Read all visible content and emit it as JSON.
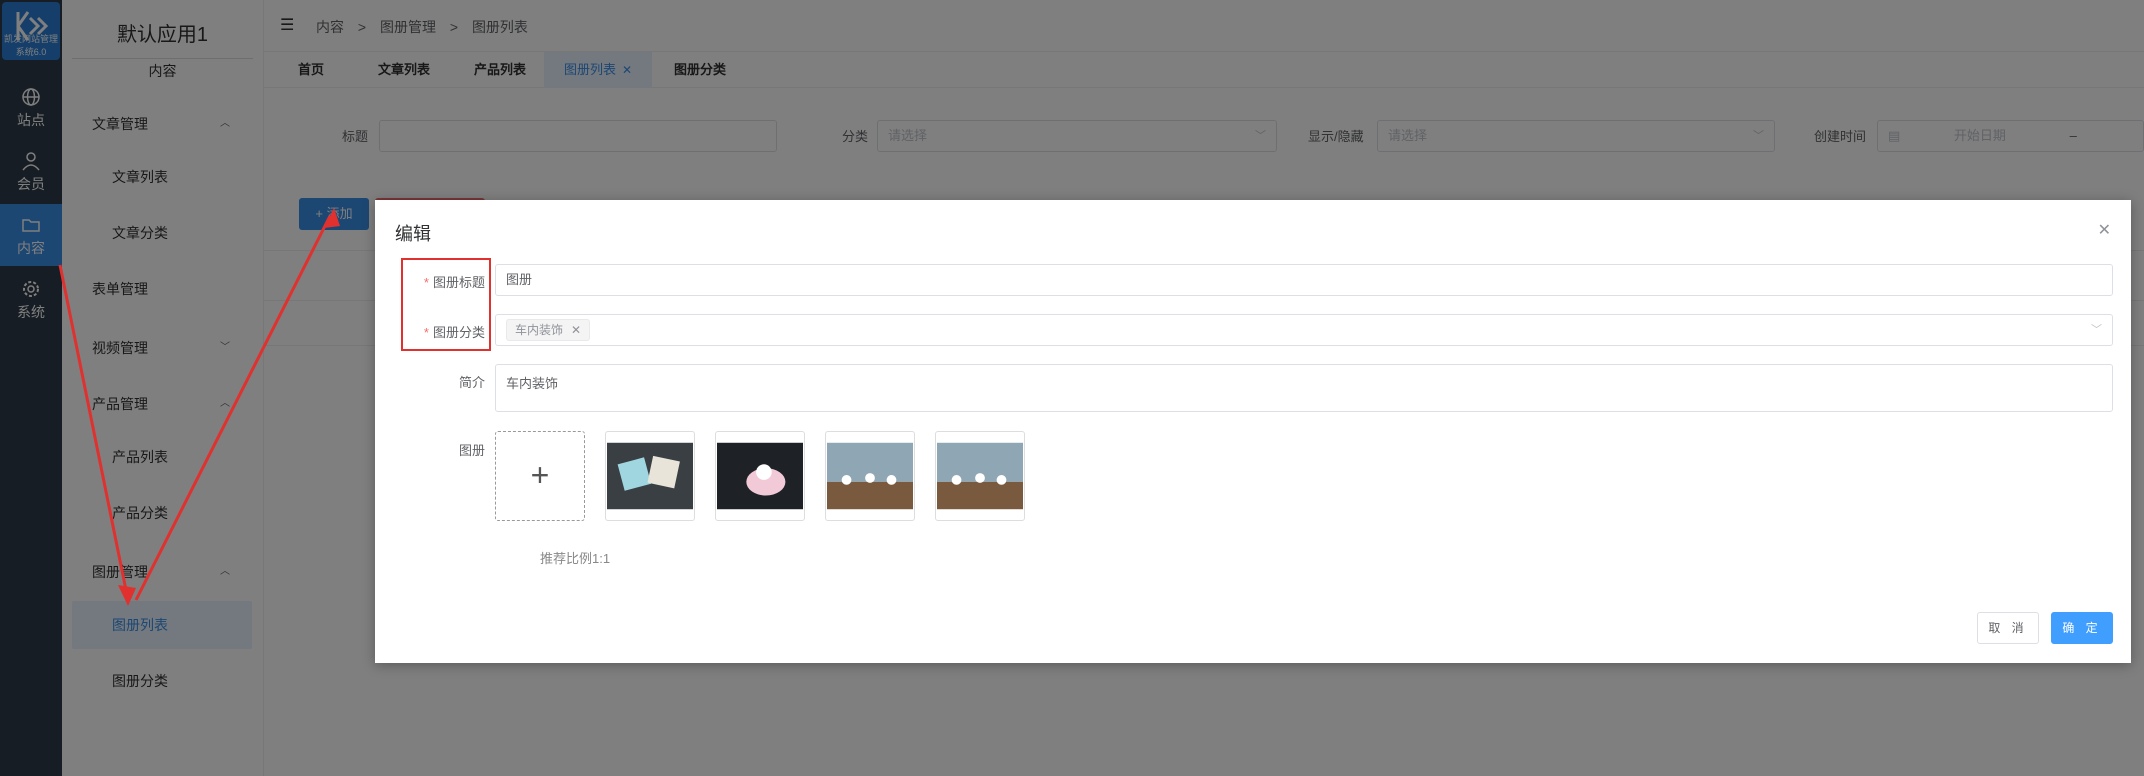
{
  "logo": {
    "subtitle": "凯发网站管理系统6.0"
  },
  "rail": [
    {
      "label": "站点",
      "icon": "globe-icon"
    },
    {
      "label": "会员",
      "icon": "user-icon"
    },
    {
      "label": "内容",
      "icon": "folder-icon"
    },
    {
      "label": "系统",
      "icon": "gear-icon"
    }
  ],
  "sidebar": {
    "app_title": "默认应用1",
    "section_title": "内容",
    "items": [
      {
        "label": "文章管理"
      },
      {
        "label": "文章列表"
      },
      {
        "label": "文章分类"
      },
      {
        "label": "表单管理"
      },
      {
        "label": "视频管理"
      },
      {
        "label": "产品管理"
      },
      {
        "label": "产品列表"
      },
      {
        "label": "产品分类"
      },
      {
        "label": "图册管理"
      },
      {
        "label": "图册列表"
      },
      {
        "label": "图册分类"
      }
    ]
  },
  "breadcrumb": [
    "内容",
    ">",
    "图册管理",
    ">",
    "图册列表"
  ],
  "tabs": [
    {
      "label": "首页"
    },
    {
      "label": "文章列表"
    },
    {
      "label": "产品列表"
    },
    {
      "label": "图册列表"
    },
    {
      "label": "图册分类"
    }
  ],
  "filters": {
    "title_label": "标题",
    "category_label": "分类",
    "category_placeholder": "请选择",
    "visibility_label": "显示/隐藏",
    "visibility_placeholder": "请选择",
    "created_label": "创建时间",
    "start_date_placeholder": "开始日期",
    "date_sep": "–"
  },
  "toolbar": {
    "add_label": "+ 添加"
  },
  "dialog": {
    "title": "编辑",
    "fields": {
      "title_label": "图册标题",
      "title_value": "图册",
      "category_label": "图册分类",
      "category_tag": "车内装饰",
      "intro_label": "简介",
      "intro_value": "车内装饰",
      "gallery_label": "图册"
    },
    "upload_plus": "+",
    "hint": "推荐比例1:1",
    "cancel_label": "取 消",
    "confirm_label": "确 定"
  },
  "colors": {
    "accent": "#3a8ee6",
    "annotation": "#e0312f"
  }
}
